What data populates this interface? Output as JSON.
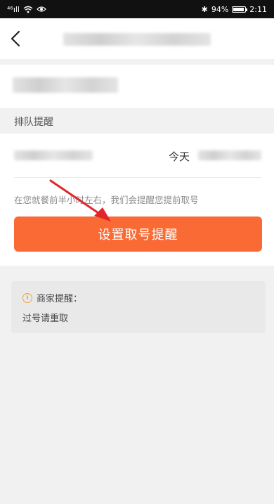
{
  "status_bar": {
    "signal": "⁴⁶ıll",
    "bluetooth": "✱",
    "battery_percent": "94%",
    "battery_level": 0.94,
    "time": "2:11"
  },
  "nav": {
    "back_icon": "chevron-left-icon"
  },
  "section": {
    "queue_reminder_label": "排队提醒"
  },
  "reminder": {
    "today_label": "今天",
    "hint_text": "在您就餐前半小时左右，我们会提醒您提前取号",
    "button_label": "设置取号提醒"
  },
  "notice": {
    "title": "商家提醒：",
    "body": "过号请重取",
    "icon": "info-icon"
  },
  "colors": {
    "accent": "#f96a34",
    "annotation_arrow": "#e0262b",
    "info_icon": "#f0a43a"
  }
}
